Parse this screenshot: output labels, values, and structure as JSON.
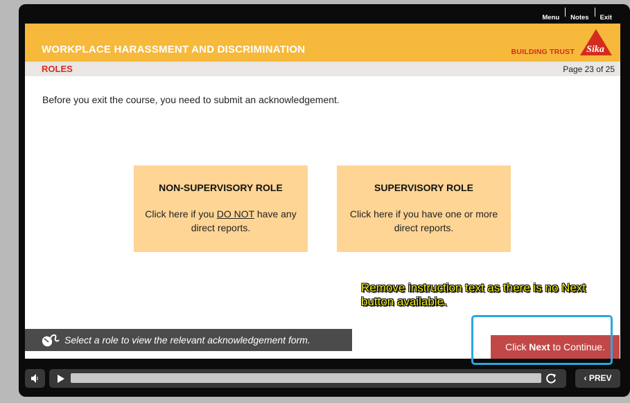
{
  "topnav": {
    "menu": "Menu",
    "notes": "Notes",
    "exit": "Exit"
  },
  "header": {
    "course_title": "WORKPLACE HARASSMENT AND DISCRIMINATION",
    "brand": "BUILDING TRUST",
    "logo_text": "Sika",
    "section": "ROLES",
    "page": "Page 23 of 25"
  },
  "main": {
    "intro": "Before you exit the course, you need to submit an acknowledgement.",
    "cards": [
      {
        "title": "NON-SUPERVISORY ROLE",
        "text_pre": "Click here if you ",
        "text_emph": "DO NOT",
        "text_post": " have any direct reports."
      },
      {
        "title": "SUPERVISORY ROLE",
        "text": "Click here if you have one or more direct reports."
      }
    ],
    "review_note": "Remove instruction text as there is no Next button available.",
    "instruction": "Select a role to view the relevant acknowledgement form.",
    "next": {
      "pre": "Click ",
      "bold": "Next",
      "post": " to Continue."
    }
  },
  "controls": {
    "prev": "PREV"
  },
  "colors": {
    "banner": "#f6b93b",
    "accent_red": "#d52b1e",
    "card": "#fed595",
    "highlight": "#2aa7e2",
    "next_button": "#c24848"
  }
}
